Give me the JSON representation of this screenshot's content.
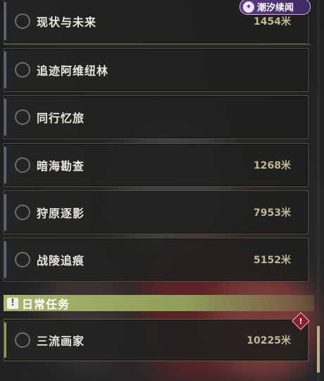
{
  "event_tag": {
    "label": "潮汐续闻",
    "icon": "swirl-icon"
  },
  "quests": [
    {
      "name": "现状与未来",
      "distance": "1454米"
    },
    {
      "name": "追迹阿维纽林",
      "distance": ""
    },
    {
      "name": "同行忆旅",
      "distance": ""
    },
    {
      "name": "暗海勘查",
      "distance": "1268米"
    },
    {
      "name": "狩原逐影",
      "distance": "7953米"
    },
    {
      "name": "战陵追痕",
      "distance": "5152米"
    }
  ],
  "daily_section": {
    "title": "日常任务",
    "icon": "exclamation-icon"
  },
  "daily_quests": [
    {
      "name": "三流画家",
      "distance": "10225米",
      "alert": "!"
    }
  ],
  "colors": {
    "tag_purple": "#5d3f82",
    "section_green": "#a9b66f",
    "distance_gold": "#c2b796",
    "alert_red": "#8a1e2e"
  }
}
